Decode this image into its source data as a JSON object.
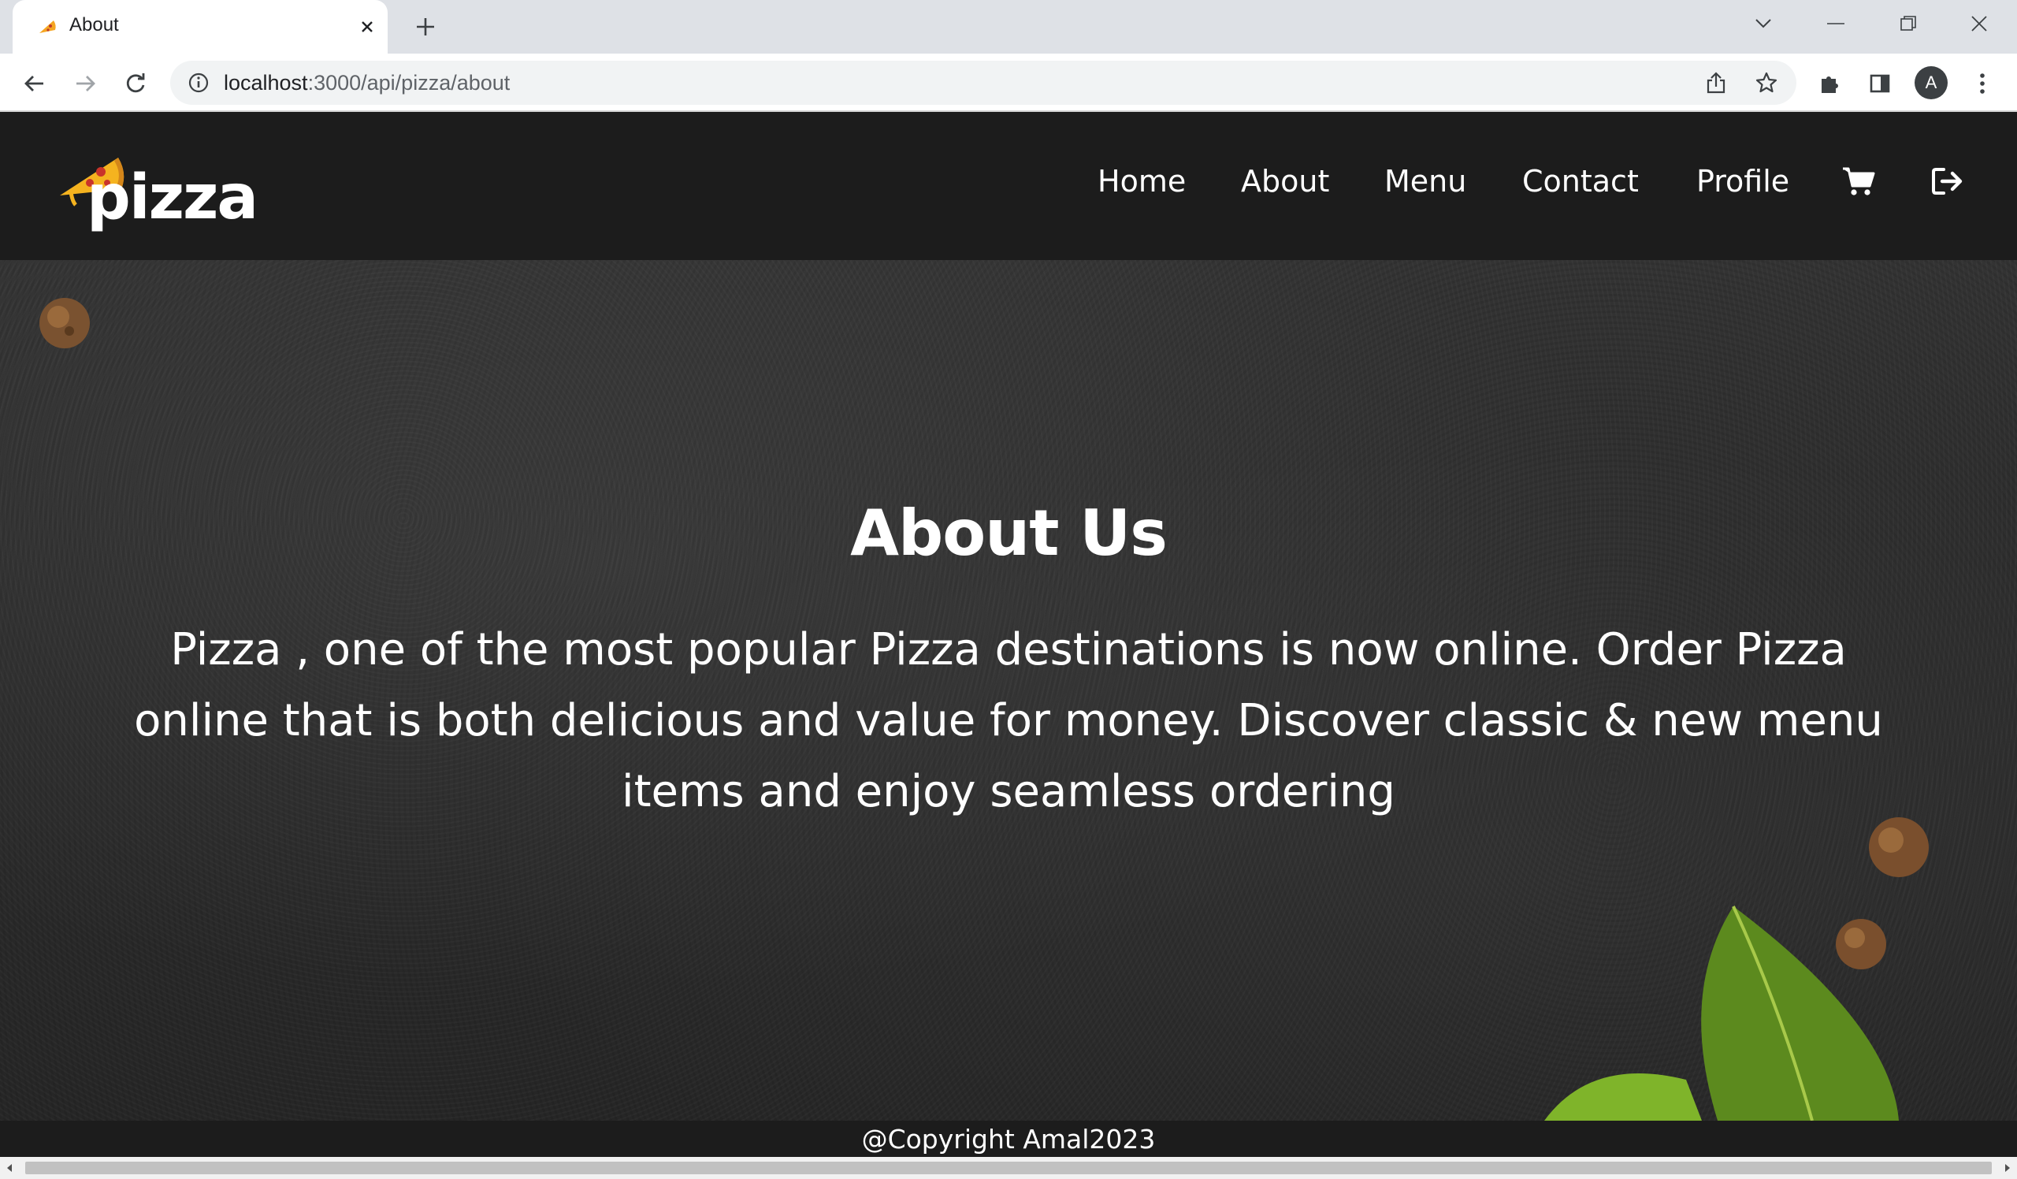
{
  "browser": {
    "tab": {
      "title": "About",
      "favicon": "pizza-slice-favicon"
    },
    "address_bar": {
      "host": "localhost",
      "path": ":3000/api/pizza/about"
    },
    "icons": [
      "back-arrow-icon",
      "forward-arrow-icon",
      "reload-icon",
      "site-info-icon",
      "share-icon",
      "bookmark-star-icon",
      "extensions-puzzle-icon",
      "side-panel-icon",
      "kebab-menu-icon",
      "minimize-icon",
      "restore-icon",
      "close-window-icon",
      "tab-search-chevron-icon"
    ],
    "profile_initial": "A"
  },
  "site": {
    "logo_text": "pizza",
    "nav": [
      {
        "label": "Home"
      },
      {
        "label": "About"
      },
      {
        "label": "Menu"
      },
      {
        "label": "Contact"
      },
      {
        "label": "Profile"
      }
    ],
    "header_icons": [
      "cart-icon",
      "logout-icon"
    ]
  },
  "hero": {
    "title": "About Us",
    "text": "Pizza , one of the most popular Pizza destinations is now online. Order Pizza online that is both delicious and value for money. Discover classic & new menu items and enjoy seamless ordering"
  },
  "footer": {
    "copyright": "@Copyright Amal2023"
  },
  "colors": {
    "header_bg": "#1c1c1c",
    "hero_bg": "#2e2e2e",
    "text": "#ffffff",
    "logo_accent": "#f5a623"
  }
}
